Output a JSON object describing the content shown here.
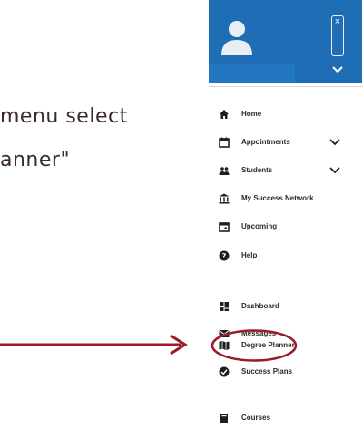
{
  "instruction": {
    "line1": "menu select",
    "line2": "anner\""
  },
  "header": {
    "close_glyph": "×"
  },
  "menu": {
    "items": [
      {
        "label": "Home",
        "icon": "home-icon"
      },
      {
        "label": "Appointments",
        "icon": "calendar-icon",
        "expandable": true
      },
      {
        "label": "Students",
        "icon": "people-icon",
        "expandable": true
      },
      {
        "label": "My Success Network",
        "icon": "institution-icon"
      },
      {
        "label": "Upcoming",
        "icon": "calendar-icon"
      },
      {
        "label": "Help",
        "icon": "help-icon"
      },
      {
        "label": "Dashboard",
        "icon": "dashboard-icon"
      },
      {
        "label": "Messages",
        "icon": "envelope-icon"
      },
      {
        "label": "Degree Planner",
        "icon": "map-icon",
        "highlighted": true
      },
      {
        "label": "Success Plans",
        "icon": "check-circle-icon"
      },
      {
        "label": "Courses",
        "icon": "book-icon"
      }
    ]
  },
  "colors": {
    "header_bg": "#1f6db4",
    "annotation": "#9c1b28",
    "menu_text": "#2b2b2b"
  }
}
